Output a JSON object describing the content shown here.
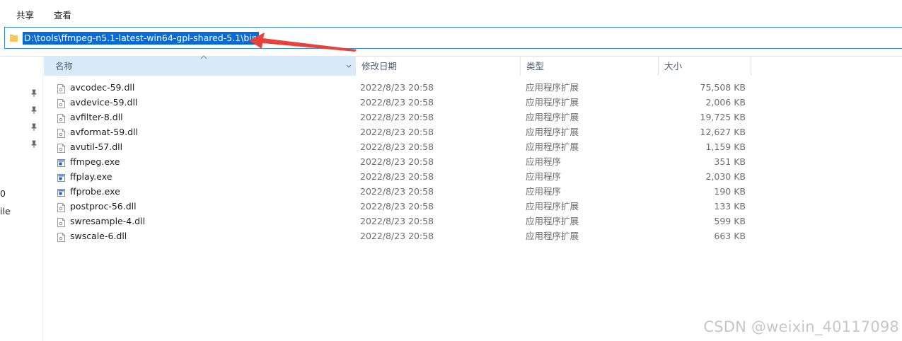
{
  "ribbon": {
    "tabs": [
      "共享",
      "查看"
    ]
  },
  "address": {
    "path": "D:\\tools\\ffmpeg-n5.1-latest-win64-gpl-shared-5.1\\bin"
  },
  "nav": {
    "partial_labels": [
      "0",
      "ile"
    ],
    "icons": [
      "pin-icon",
      "pin-icon",
      "pin-icon",
      "pin-icon"
    ]
  },
  "columns": {
    "name": "名称",
    "date": "修改日期",
    "type": "类型",
    "size": "大小"
  },
  "files": [
    {
      "name": "avcodec-59.dll",
      "date": "2022/8/23 20:58",
      "type": "应用程序扩展",
      "size": "75,508 KB",
      "icon": "dll-file-icon"
    },
    {
      "name": "avdevice-59.dll",
      "date": "2022/8/23 20:58",
      "type": "应用程序扩展",
      "size": "2,006 KB",
      "icon": "dll-file-icon"
    },
    {
      "name": "avfilter-8.dll",
      "date": "2022/8/23 20:58",
      "type": "应用程序扩展",
      "size": "19,725 KB",
      "icon": "dll-file-icon"
    },
    {
      "name": "avformat-59.dll",
      "date": "2022/8/23 20:58",
      "type": "应用程序扩展",
      "size": "12,627 KB",
      "icon": "dll-file-icon"
    },
    {
      "name": "avutil-57.dll",
      "date": "2022/8/23 20:58",
      "type": "应用程序扩展",
      "size": "1,159 KB",
      "icon": "dll-file-icon"
    },
    {
      "name": "ffmpeg.exe",
      "date": "2022/8/23 20:58",
      "type": "应用程序",
      "size": "351 KB",
      "icon": "exe-file-icon"
    },
    {
      "name": "ffplay.exe",
      "date": "2022/8/23 20:58",
      "type": "应用程序",
      "size": "2,030 KB",
      "icon": "exe-file-icon"
    },
    {
      "name": "ffprobe.exe",
      "date": "2022/8/23 20:58",
      "type": "应用程序",
      "size": "190 KB",
      "icon": "exe-file-icon"
    },
    {
      "name": "postproc-56.dll",
      "date": "2022/8/23 20:58",
      "type": "应用程序扩展",
      "size": "133 KB",
      "icon": "dll-file-icon"
    },
    {
      "name": "swresample-4.dll",
      "date": "2022/8/23 20:58",
      "type": "应用程序扩展",
      "size": "599 KB",
      "icon": "dll-file-icon"
    },
    {
      "name": "swscale-6.dll",
      "date": "2022/8/23 20:58",
      "type": "应用程序扩展",
      "size": "663 KB",
      "icon": "dll-file-icon"
    }
  ],
  "watermark": "CSDN @weixin_40117098",
  "colors": {
    "selection": "#0a6ad6",
    "sorted_header": "#d9ebf9",
    "annotation_arrow": "#e8413b"
  }
}
